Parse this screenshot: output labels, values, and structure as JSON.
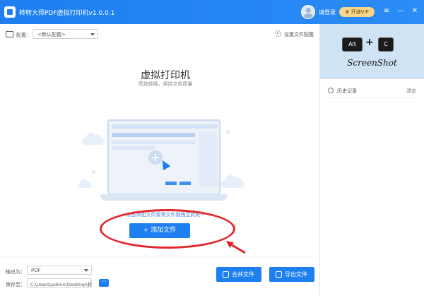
{
  "app": {
    "title": "转转大师PDF虚拟打印机v1.0.0.1"
  },
  "header": {
    "login_label": "请登录",
    "vip_label": "开通VIP",
    "vip_icon": "crown-icon"
  },
  "window_controls": {
    "menu": "≡",
    "minimize": "—",
    "close": "✕"
  },
  "config": {
    "label": "配置：",
    "selected": "<默认配置>",
    "settings_label": "设置文件配置"
  },
  "hero": {
    "title": "虚拟打印机",
    "subtitle": "高效转换，保持文件质量"
  },
  "dropzone": {
    "hint": "点击添加文件或将文件拖拽至此处~",
    "add_button": "+ 添加文件"
  },
  "output": {
    "format_label": "输出为：",
    "format_value": "PDF",
    "save_label": "保存至：",
    "save_path": "C:\\Users\\admin\\Desktop\\转...",
    "browse_label": "···"
  },
  "actions": {
    "merge_label": "合并文件",
    "export_label": "导出文件"
  },
  "sidebar": {
    "promo_key1": "Alt",
    "promo_plus": "+",
    "promo_key2": "C",
    "promo_text": "ScreenShot",
    "history_label": "历史记录",
    "clear_label": "清空"
  },
  "colors": {
    "brand_blue": "#1e7ff0",
    "annotation_red": "#e3262b",
    "vip_gold": "#f6d78b"
  }
}
